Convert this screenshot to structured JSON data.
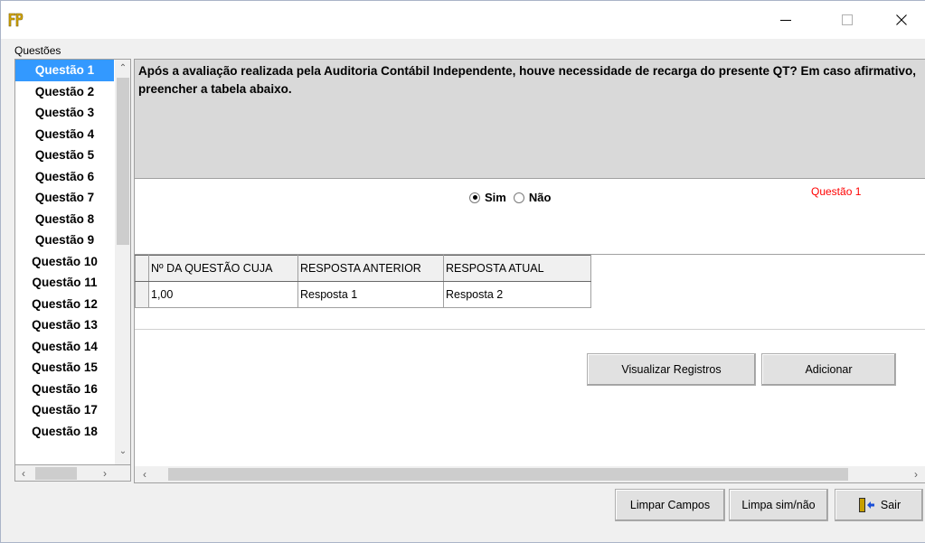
{
  "window": {
    "app_icon": "fp-logo-icon",
    "controls": {
      "minimize": "minimize-icon",
      "maximize": "maximize-icon",
      "close": "close-icon"
    }
  },
  "questions_group": {
    "label": "Questões",
    "items": [
      "Questão 1",
      "Questão 2",
      "Questão 3",
      "Questão 4",
      "Questão 5",
      "Questão 6",
      "Questão 7",
      "Questão 8",
      "Questão 9",
      "Questão 10",
      "Questão 11",
      "Questão 12",
      "Questão 13",
      "Questão 14",
      "Questão 15",
      "Questão 16",
      "Questão 17",
      "Questão 18"
    ],
    "selected_index": 0
  },
  "question": {
    "text": "Após a avaliação realizada pela Auditoria Contábil Independente, houve necessidade de recarga do presente QT? Em caso afirmativo, preencher a tabela abaixo.",
    "options": {
      "sim": "Sim",
      "nao": "Não"
    },
    "selected": "sim",
    "tag": "Questão 1"
  },
  "grid": {
    "headers": [
      "Nº DA QUESTÃO CUJA",
      "RESPOSTA ANTERIOR",
      "RESPOSTA ATUAL"
    ],
    "rows": [
      [
        "1,00",
        "Resposta 1",
        "Resposta 2"
      ]
    ]
  },
  "actions": {
    "visualizar": "Visualizar Registros",
    "adicionar": "Adicionar",
    "limpar_campos": "Limpar Campos",
    "limpa_sim_nao": "Limpa sim/não",
    "sair": "Sair"
  },
  "colors": {
    "selection": "#3399ff",
    "question_tag": "#ff0000",
    "question_panel": "#d9d9d9"
  }
}
